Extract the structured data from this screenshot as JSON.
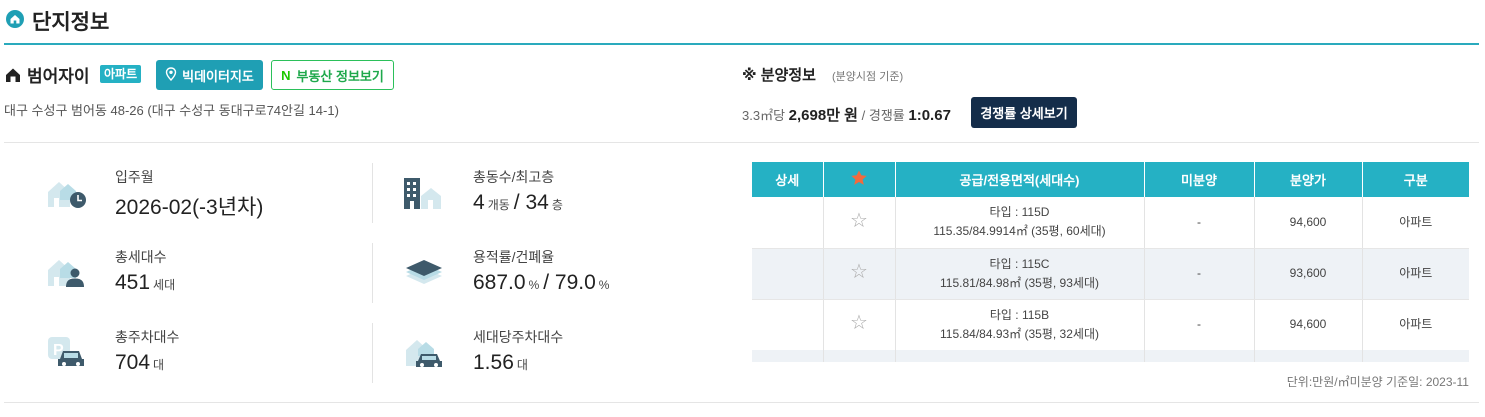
{
  "section": {
    "title": "단지정보",
    "icon": "home-icon"
  },
  "complex": {
    "name": "범어자이",
    "type_badge": "아파트",
    "address": "대구 수성구 범어동 48-26 (대구 수성구 동대구로74안길 14-1)"
  },
  "buttons": {
    "bigdata_map": "빅데이터지도",
    "naver_prefix": "N",
    "naver_label": "부동산 정보보기",
    "competition_detail": "경쟁률 상세보기"
  },
  "sale": {
    "title": "※ 분양정보",
    "note": "(분양시점 기준)",
    "price_unit_label": "3.3㎡당",
    "price": "2,698만 원",
    "sep": "/",
    "competition_label": "경쟁률",
    "competition": "1:0.67"
  },
  "stats": [
    {
      "label": "입주월",
      "value": "2026-02(-3년차)",
      "icon": "house-clock-icon"
    },
    {
      "label": "총동수/최고층",
      "value1": "4",
      "unit1": "개동",
      "sep": "/",
      "value2": "34",
      "unit2": "층",
      "icon": "buildings-icon"
    },
    {
      "label": "총세대수",
      "value1": "451",
      "unit1": "세대",
      "icon": "house-person-icon"
    },
    {
      "label": "용적률/건폐율",
      "value1": "687.0",
      "unit1": "%",
      "sep": "/",
      "value2": "79.0",
      "unit2": "%",
      "icon": "layers-icon"
    },
    {
      "label": "총주차대수",
      "value1": "704",
      "unit1": "대",
      "icon": "parking-car-icon"
    },
    {
      "label": "세대당주차대수",
      "value1": "1.56",
      "unit1": "대",
      "icon": "house-car-icon"
    }
  ],
  "table": {
    "headers": [
      "상세",
      "★",
      "공급/전용면적(세대수)",
      "미분양",
      "분양가",
      "구분"
    ],
    "rows": [
      {
        "type": "타입 : 115D",
        "area": "115.35/84.9914㎡ (35평, 60세대)",
        "unsold": "-",
        "price": "94,600",
        "category": "아파트"
      },
      {
        "type": "타입 : 115C",
        "area": "115.81/84.98㎡ (35평, 93세대)",
        "unsold": "-",
        "price": "93,600",
        "category": "아파트"
      },
      {
        "type": "타입 : 115B",
        "area": "115.84/84.93㎡ (35평, 32세대)",
        "unsold": "-",
        "price": "94,600",
        "category": "아파트"
      }
    ],
    "note": "단위:만원/㎡미분양 기준일: 2023-11"
  },
  "colors": {
    "accent": "#25b1c4",
    "dark_button": "#142d4a",
    "naver_green": "#1ec800",
    "star_orange": "#f26a3d"
  }
}
